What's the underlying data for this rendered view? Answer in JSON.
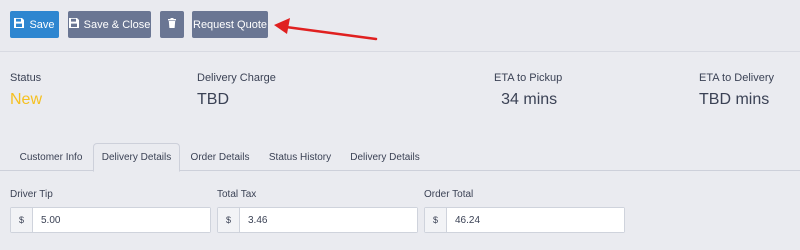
{
  "toolbar": {
    "save_label": "Save",
    "save_close_label": "Save & Close",
    "request_quote_label": "Request Quote"
  },
  "summary": {
    "status_label": "Status",
    "status_value": "New",
    "delivery_charge_label": "Delivery Charge",
    "delivery_charge_value": "TBD",
    "eta_pickup_label": "ETA to Pickup",
    "eta_pickup_value": "34 mins",
    "eta_delivery_label": "ETA to Delivery",
    "eta_delivery_value": "TBD mins"
  },
  "tabs": [
    {
      "label": "Customer Info"
    },
    {
      "label": "Delivery Details",
      "active": true
    },
    {
      "label": "Order Details"
    },
    {
      "label": "Status History"
    },
    {
      "label": "Delivery Details"
    }
  ],
  "fields": {
    "driver_tip": {
      "label": "Driver Tip",
      "currency": "$",
      "value": "5.00"
    },
    "total_tax": {
      "label": "Total Tax",
      "currency": "$",
      "value": "3.46"
    },
    "order_total": {
      "label": "Order Total",
      "currency": "$",
      "value": "46.24"
    }
  },
  "colors": {
    "primary": "#2e86d0",
    "secondary": "#6a7693",
    "status_new": "#f5c020",
    "annotation_arrow": "#e02020"
  },
  "icons": {
    "save": "floppy-disk-icon",
    "delete": "trash-icon",
    "annotation": "red-arrow-icon"
  }
}
